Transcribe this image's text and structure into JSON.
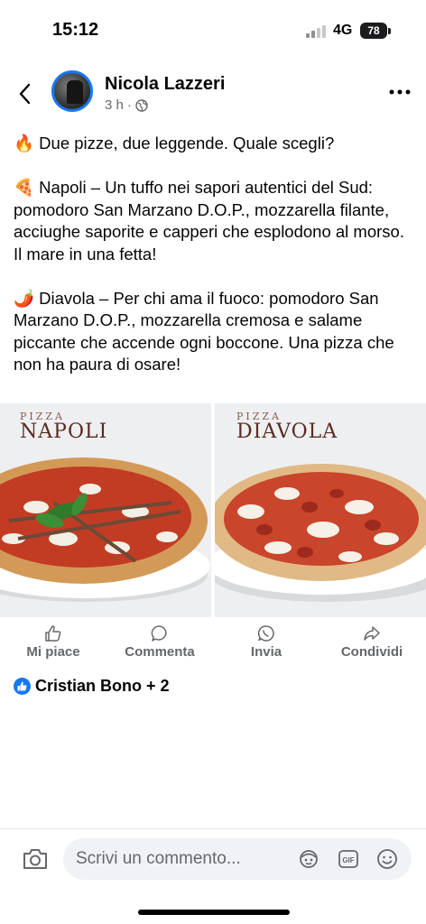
{
  "status_bar": {
    "time": "15:12",
    "network": "4G",
    "battery": "78"
  },
  "post": {
    "author": "Nicola Lazzeri",
    "time": "3 h",
    "separator": "·",
    "text": {
      "line1": "🔥 Due pizze, due leggende. Quale scegli?",
      "napoli": "🍕 Napoli – Un tuffo nei sapori autentici del Sud: pomodoro San Marzano D.O.P., mozzarella filante, acciughe saporite e capperi che esplodono al morso. Il mare in una fetta!",
      "diavola": "🌶️ Diavola – Per chi ama il fuoco: pomodoro San Marzano D.O.P., mozzarella cremosa e salame piccante che accende ogni boccone. Una pizza che non ha paura di osare!"
    },
    "photos": [
      {
        "small": "PIZZA",
        "big": "NAPOLI"
      },
      {
        "small": "PIZZA",
        "big": "DIAVOLA"
      }
    ]
  },
  "actions": {
    "like": "Mi piace",
    "comment": "Commenta",
    "send": "Invia",
    "share": "Condividi"
  },
  "reactions": {
    "names": "Cristian Bono + 2"
  },
  "comment_bar": {
    "placeholder": "Scrivi un commento..."
  },
  "colors": {
    "accent": "#1877f2",
    "muted": "#65676b"
  }
}
